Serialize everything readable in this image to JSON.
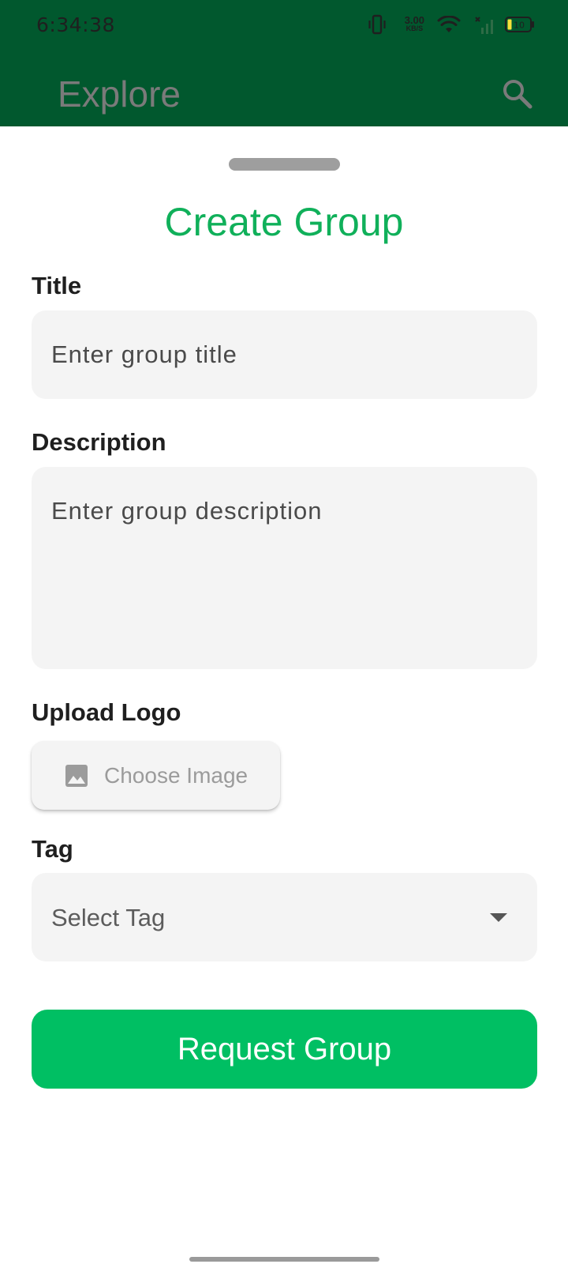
{
  "status_bar": {
    "time": "6:34:38",
    "net_speed_value": "3.00",
    "net_speed_unit": "KB/S",
    "battery_level": "10"
  },
  "app_bar": {
    "title": "Explore",
    "search_icon": "search-icon"
  },
  "sheet": {
    "title": "Create Group",
    "title_label": "Title",
    "title_placeholder": "Enter group title",
    "description_label": "Description",
    "description_placeholder": "Enter group description",
    "logo_label": "Upload Logo",
    "choose_image_label": "Choose Image",
    "tag_label": "Tag",
    "tag_placeholder": "Select Tag",
    "submit_label": "Request Group"
  },
  "colors": {
    "app_bar": "#01582e",
    "accent": "#10b05a",
    "button": "#00bf63",
    "field_bg": "#f4f4f4"
  }
}
